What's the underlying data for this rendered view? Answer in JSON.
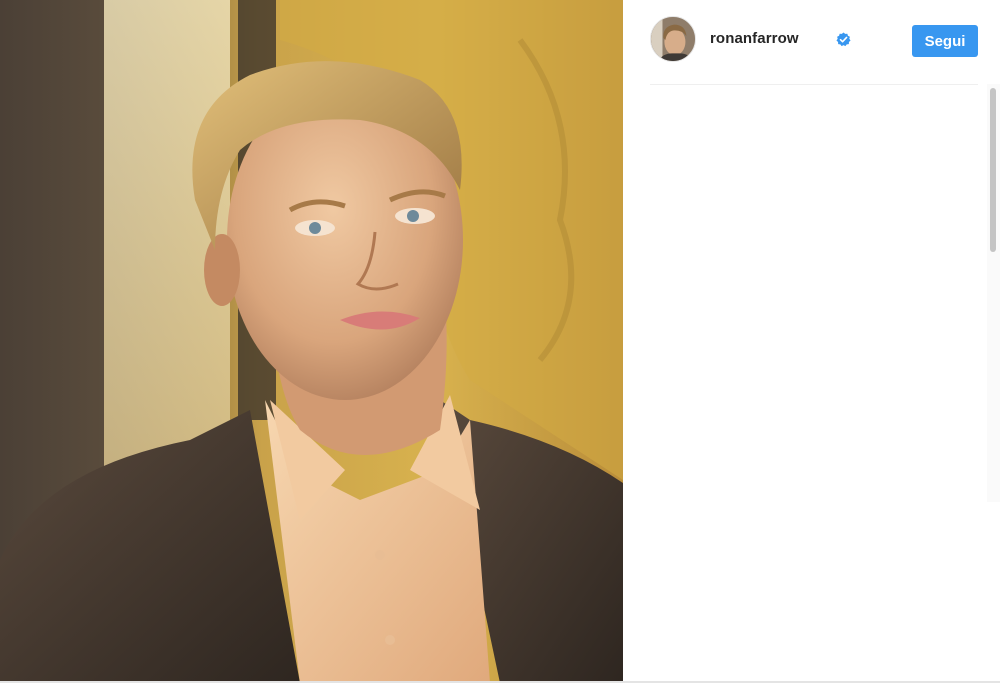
{
  "post": {
    "photo_name": "portrait-photo",
    "author": {
      "username": "ronanfarrow",
      "verified": true
    },
    "follow_label": "Segui"
  },
  "colors": {
    "accent": "#3897f0",
    "text": "#262626",
    "divider": "#efefef"
  },
  "icons": {
    "verified": "verified-badge-icon"
  }
}
